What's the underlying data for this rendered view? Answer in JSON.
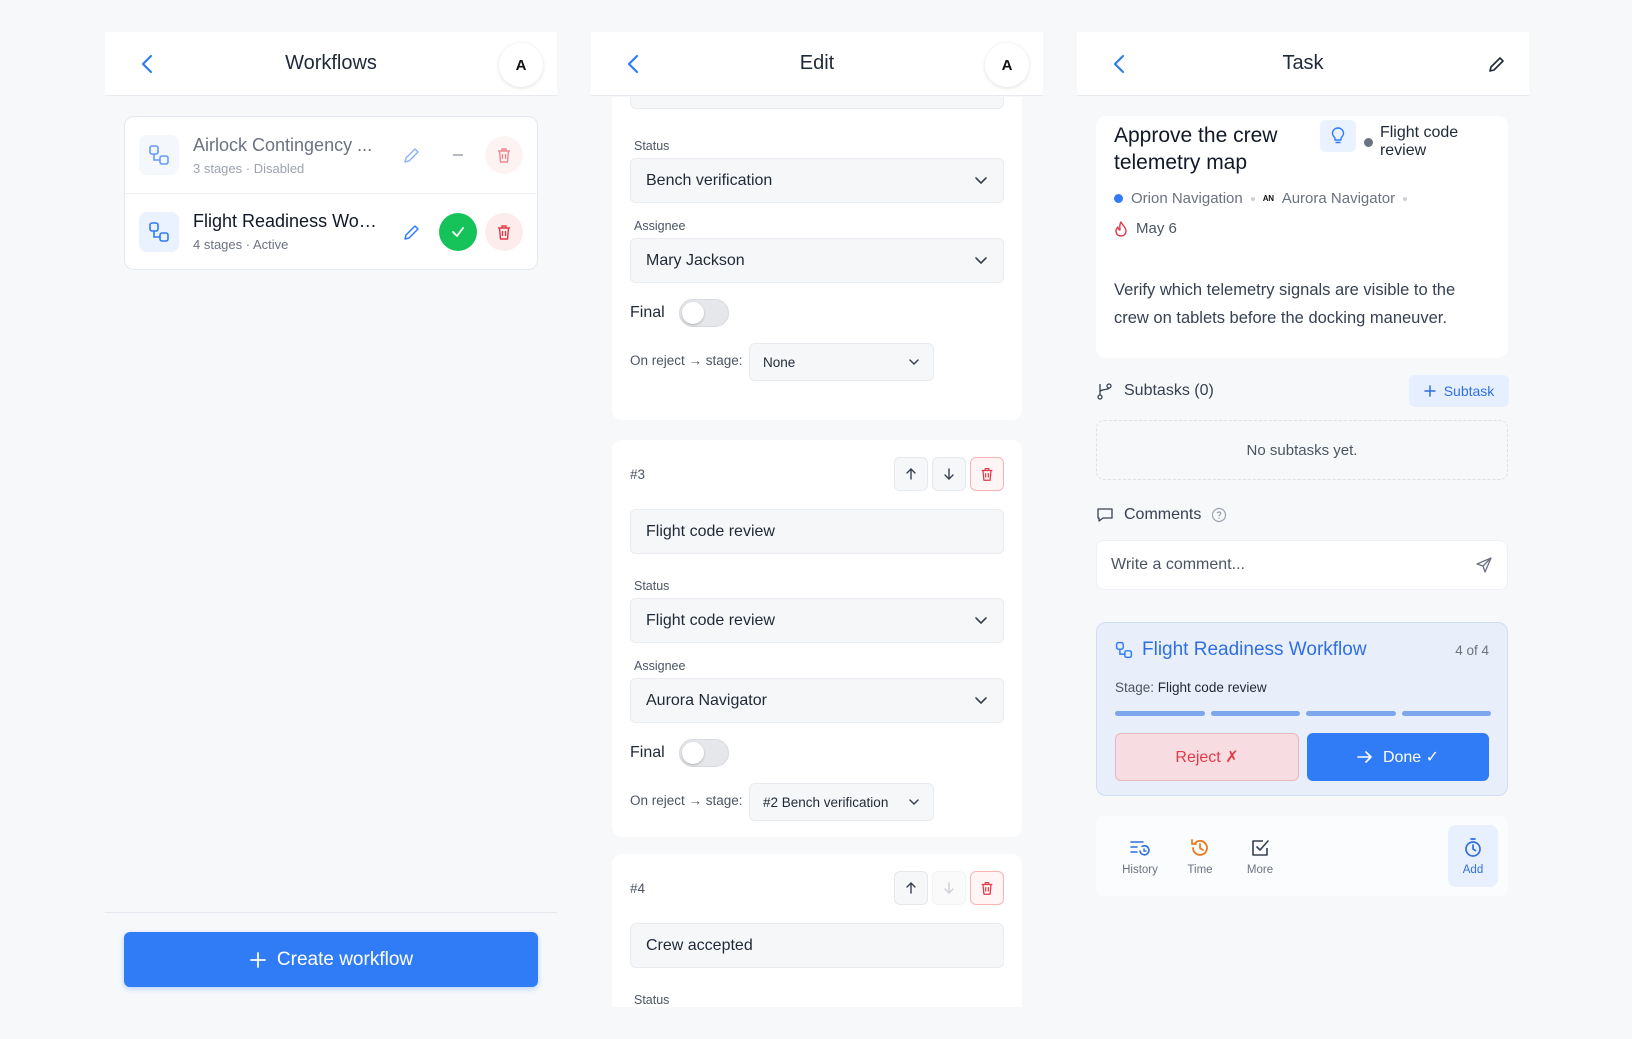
{
  "workflows_panel": {
    "title": "Workflows",
    "avatar": "A",
    "items": [
      {
        "name": "Airlock Contingency ...",
        "sub": "3 stages · Disabled",
        "state": "disabled"
      },
      {
        "name": "Flight Readiness Wor...",
        "sub": "4 stages · Active",
        "state": "active"
      }
    ],
    "create_label": "Create workflow"
  },
  "edit_panel": {
    "title": "Edit",
    "avatar": "A",
    "labels": {
      "status": "Status",
      "assignee": "Assignee",
      "final": "Final",
      "on_reject": "On reject → stage:"
    },
    "stage2": {
      "status": "Bench verification",
      "assignee": "Mary Jackson",
      "final": false,
      "on_reject": "None"
    },
    "stage3": {
      "num": "#3",
      "name": "Flight code review",
      "status": "Flight code review",
      "assignee": "Aurora Navigator",
      "final": false,
      "on_reject": "#2 Bench verification"
    },
    "stage4": {
      "num": "#4",
      "name": "Crew accepted",
      "status_label_partial": "Status"
    }
  },
  "task_panel": {
    "title": "Task",
    "task_title": "Approve the crew telemetry map",
    "stage_tag": "Flight code review",
    "project": "Orion Navigation",
    "assignee_initials": "AN",
    "assignee": "Aurora Navigator",
    "due": "May 6",
    "description": "Verify which telemetry signals are visible to the crew on tablets before the docking maneuver.",
    "subtasks_label": "Subtasks (0)",
    "subtask_button": "Subtask",
    "subtasks_empty": "No subtasks yet.",
    "comments_label": "Comments",
    "comment_placeholder": "Write a comment...",
    "workflow": {
      "name": "Flight Readiness Workflow",
      "count": "4 of 4",
      "stage_prefix": "Stage:",
      "stage": "Flight code review",
      "progress_completed": 4,
      "progress_total": 4,
      "reject_label": "Reject ✗",
      "done_label": "Done ✓"
    },
    "nav": [
      {
        "label": "History"
      },
      {
        "label": "Time"
      },
      {
        "label": "More"
      },
      {
        "label": "Add"
      }
    ],
    "colors": {
      "accent": "#2f7cf6",
      "success": "#16c35a",
      "danger": "#e03a48",
      "project_dot": "#2f7cf6",
      "stage_dot": "#6b7280"
    }
  }
}
